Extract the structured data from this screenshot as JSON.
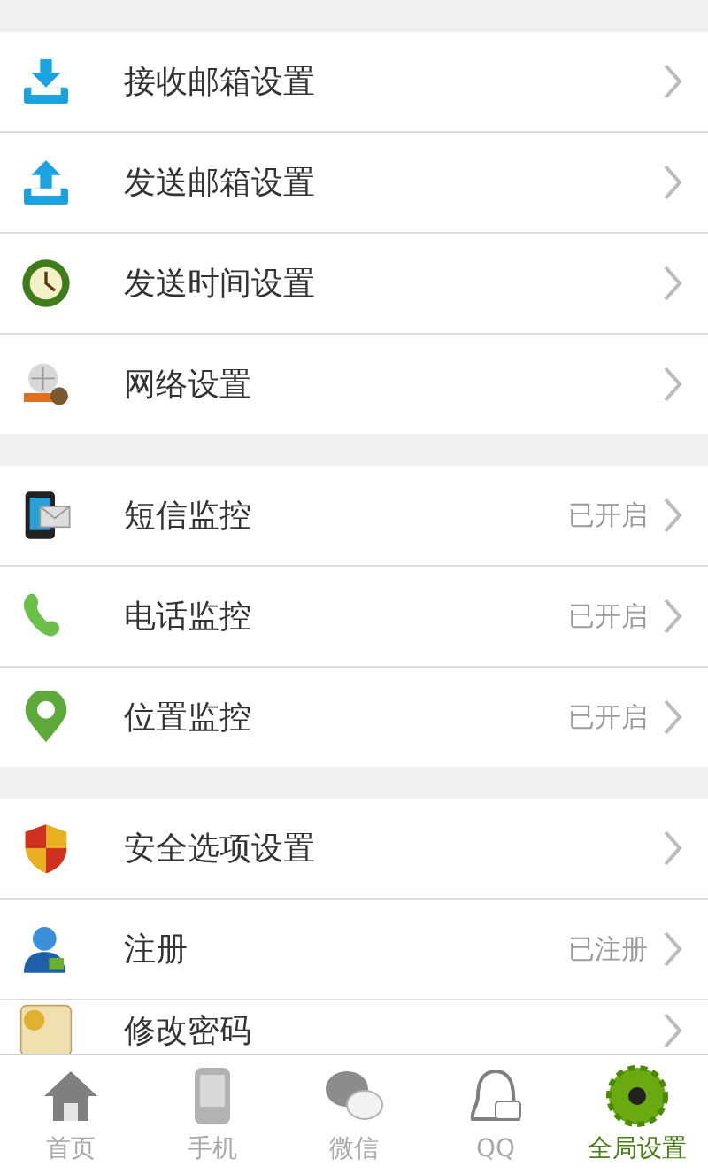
{
  "groups": [
    {
      "items": [
        {
          "label": "接收邮箱设置"
        },
        {
          "label": "发送邮箱设置"
        },
        {
          "label": "发送时间设置"
        },
        {
          "label": "网络设置"
        }
      ]
    },
    {
      "items": [
        {
          "label": "短信监控",
          "status": "已开启"
        },
        {
          "label": "电话监控",
          "status": "已开启"
        },
        {
          "label": "位置监控",
          "status": "已开启"
        }
      ]
    },
    {
      "items": [
        {
          "label": "安全选项设置"
        },
        {
          "label": "注册",
          "status": "已注册"
        },
        {
          "label": "修改密码"
        }
      ]
    }
  ],
  "tabs": [
    {
      "label": "首页",
      "selected": false
    },
    {
      "label": "手机",
      "selected": false
    },
    {
      "label": "微信",
      "selected": false
    },
    {
      "label": "QQ",
      "selected": false
    },
    {
      "label": "全局设置",
      "selected": true
    }
  ]
}
